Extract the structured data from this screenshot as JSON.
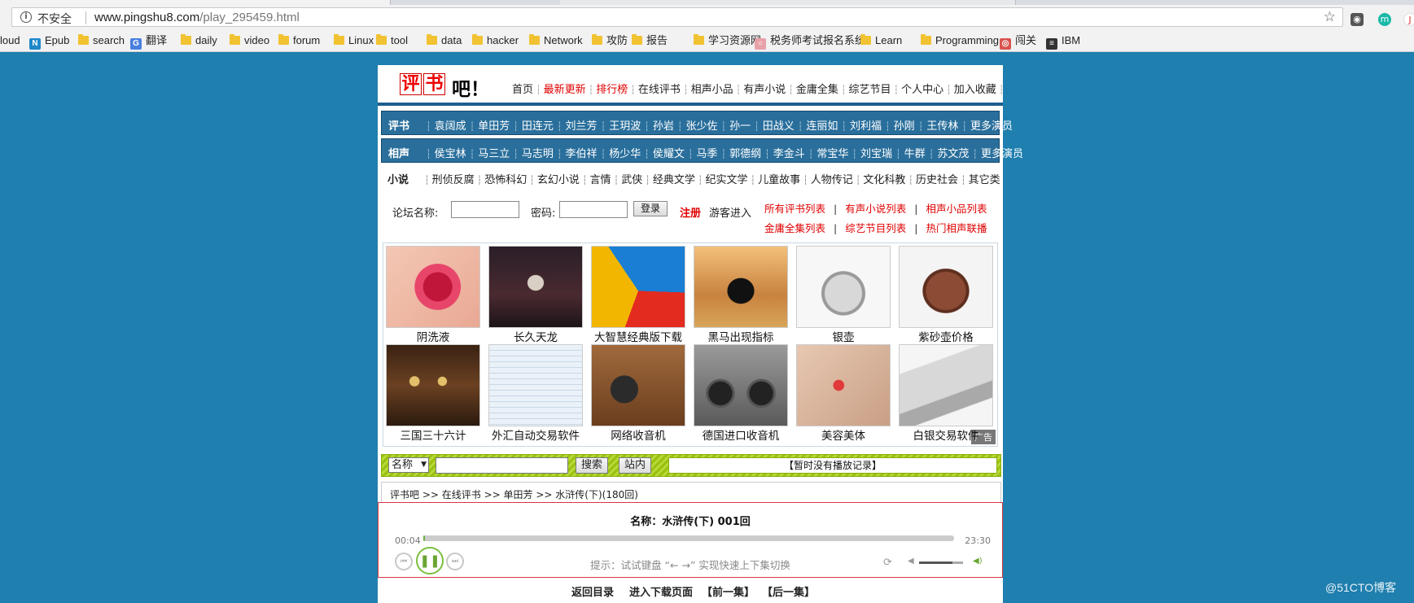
{
  "browser": {
    "insecure_label": "不安全",
    "url_host": "www.pingshu8.com",
    "url_path": "/play_295459.html",
    "bookmarks": [
      {
        "label": "loud",
        "icon": "none"
      },
      {
        "label": "Epub",
        "icon": "n-icon"
      },
      {
        "label": "search",
        "icon": "folder-icon"
      },
      {
        "label": "翻译",
        "icon": "translate-icon"
      },
      {
        "label": "daily",
        "icon": "folder-icon"
      },
      {
        "label": "video",
        "icon": "folder-icon"
      },
      {
        "label": "forum",
        "icon": "folder-icon"
      },
      {
        "label": "Linux",
        "icon": "folder-icon"
      },
      {
        "label": "tool",
        "icon": "folder-icon"
      },
      {
        "label": "data",
        "icon": "folder-icon"
      },
      {
        "label": "hacker",
        "icon": "folder-icon"
      },
      {
        "label": "Network",
        "icon": "folder-icon"
      },
      {
        "label": "攻防",
        "icon": "folder-icon"
      },
      {
        "label": "报告",
        "icon": "folder-icon"
      },
      {
        "label": "学习资源网",
        "icon": "folder-icon"
      },
      {
        "label": "税务师考试报名系统",
        "icon": "site-icon"
      },
      {
        "label": "Learn",
        "icon": "folder-icon"
      },
      {
        "label": "Programming",
        "icon": "folder-icon"
      },
      {
        "label": "闯关",
        "icon": "red-site-icon"
      },
      {
        "label": "IBM",
        "icon": "ibm-icon"
      }
    ]
  },
  "site": {
    "logo_chars": [
      "评",
      "书"
    ],
    "logo_rest": "吧！",
    "nav": [
      {
        "label": "首页",
        "red": false
      },
      {
        "label": "最新更新",
        "red": true
      },
      {
        "label": "排行榜",
        "red": true
      },
      {
        "label": "在线评书",
        "red": false
      },
      {
        "label": "相声小品",
        "red": false
      },
      {
        "label": "有声小说",
        "red": false
      },
      {
        "label": "金庸全集",
        "red": false
      },
      {
        "label": "综艺节目",
        "red": false
      },
      {
        "label": "个人中心",
        "red": false
      },
      {
        "label": "加入收藏",
        "red": false
      }
    ],
    "pingshu": {
      "label": "评书",
      "items": [
        "袁阔成",
        "单田芳",
        "田连元",
        "刘兰芳",
        "王玥波",
        "孙岩",
        "张少佐",
        "孙一",
        "田战义",
        "连丽如",
        "刘利福",
        "孙刚",
        "王传林",
        "更多演员"
      ]
    },
    "xiangsheng": {
      "label": "相声",
      "items": [
        "侯宝林",
        "马三立",
        "马志明",
        "李伯祥",
        "杨少华",
        "侯耀文",
        "马季",
        "郭德纲",
        "李金斗",
        "常宝华",
        "刘宝瑞",
        "牛群",
        "苏文茂",
        "更多演员"
      ]
    },
    "novel": {
      "label": "小说",
      "items": [
        "刑侦反腐",
        "恐怖科幻",
        "玄幻小说",
        "言情",
        "武侠",
        "经典文学",
        "纪实文学",
        "儿童故事",
        "人物传记",
        "文化科教",
        "历史社会",
        "其它类"
      ]
    },
    "login": {
      "forum_label": "论坛名称:",
      "password_label": "密码:",
      "login_button": "登录",
      "register": "注册",
      "guest": "游客进入"
    },
    "lists": {
      "row1": [
        "所有评书列表",
        "有声小说列表",
        "相声小品列表"
      ],
      "row2": [
        "金庸全集列表",
        "综艺节目列表",
        "热门相声联播"
      ]
    },
    "ads": [
      {
        "caption": "阴洗液",
        "icon": "lily-image"
      },
      {
        "caption": "长久天龙",
        "icon": "game-character-image"
      },
      {
        "caption": "大智慧经典版下载",
        "icon": "arrow-logo-image"
      },
      {
        "caption": "黑马出现指标",
        "icon": "horse-image"
      },
      {
        "caption": "银壶",
        "icon": "silver-teapot-image"
      },
      {
        "caption": "紫砂壶价格",
        "icon": "clay-teapot-image"
      },
      {
        "caption": "三国三十六计",
        "icon": "game-screen-image"
      },
      {
        "caption": "外汇自动交易软件",
        "icon": "software-screen-image"
      },
      {
        "caption": "网络收音机",
        "icon": "radio-image"
      },
      {
        "caption": "德国进口收音机",
        "icon": "boombox-image"
      },
      {
        "caption": "美容美体",
        "icon": "beauty-image"
      },
      {
        "caption": "白银交易软件",
        "icon": "silver-bar-image"
      }
    ],
    "ad_tag": "广告",
    "search": {
      "select_value": "名称",
      "search_button": "搜索",
      "site_button": "站内",
      "history": "【暂时没有播放记录】"
    },
    "breadcrumb": [
      "评书吧",
      "在线评书",
      "单田芳",
      "水浒传(下)(180回)"
    ],
    "breadcrumb_sep": ">>",
    "player": {
      "title": "名称：水浒传(下) 001回",
      "current_time": "00:04",
      "duration": "23:30",
      "progress": 0.003,
      "hint": "提示：试试键盘 “← →” 实现快速上下集切换",
      "volume": 0.75
    },
    "footer": [
      "返回目录",
      "进入下载页面",
      "【前一集】",
      "【后一集】"
    ]
  },
  "watermark": "@51CTO博客"
}
